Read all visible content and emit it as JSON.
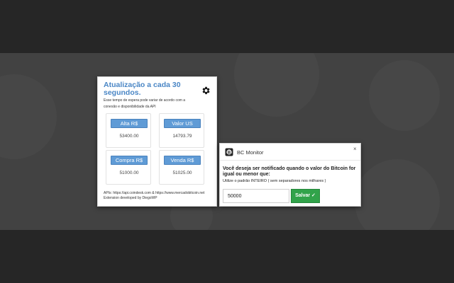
{
  "popup": {
    "title": "Atualização a cada 30 segundos.",
    "description": "Esse tempo de espera pode variar de acordo com a conexão e disponibilidade da API",
    "settings_icon": "gear-icon",
    "cards": [
      {
        "label": "Alta R$",
        "value": "53400.00"
      },
      {
        "label": "Valor US",
        "value": "14793.79"
      },
      {
        "label": "Compra R$",
        "value": "51000.00"
      },
      {
        "label": "Venda R$",
        "value": "51025.00"
      }
    ],
    "footer_apis": "APIs: https://api.coindesk.com & https://www.mercadobitcoin.net",
    "footer_credit": "Extension developed by DiegoWP"
  },
  "notification": {
    "app_icon": "bitcoin-logo-icon",
    "app_name": "BC Monitor",
    "close_symbol": "×",
    "question": "Você deseja ser notificado quando o valor do Bitcoin for igual ou menor que:",
    "hint": "Utilize o padrão INTEIRO ( sem separadores nos milhares )",
    "input_value": "50000",
    "save_label": "Salvar ✓"
  },
  "colors": {
    "title_blue": "#4a86c5",
    "button_blue": "#5f9bd6",
    "save_green": "#31a34a",
    "band": "#424242",
    "background": "#262626"
  }
}
